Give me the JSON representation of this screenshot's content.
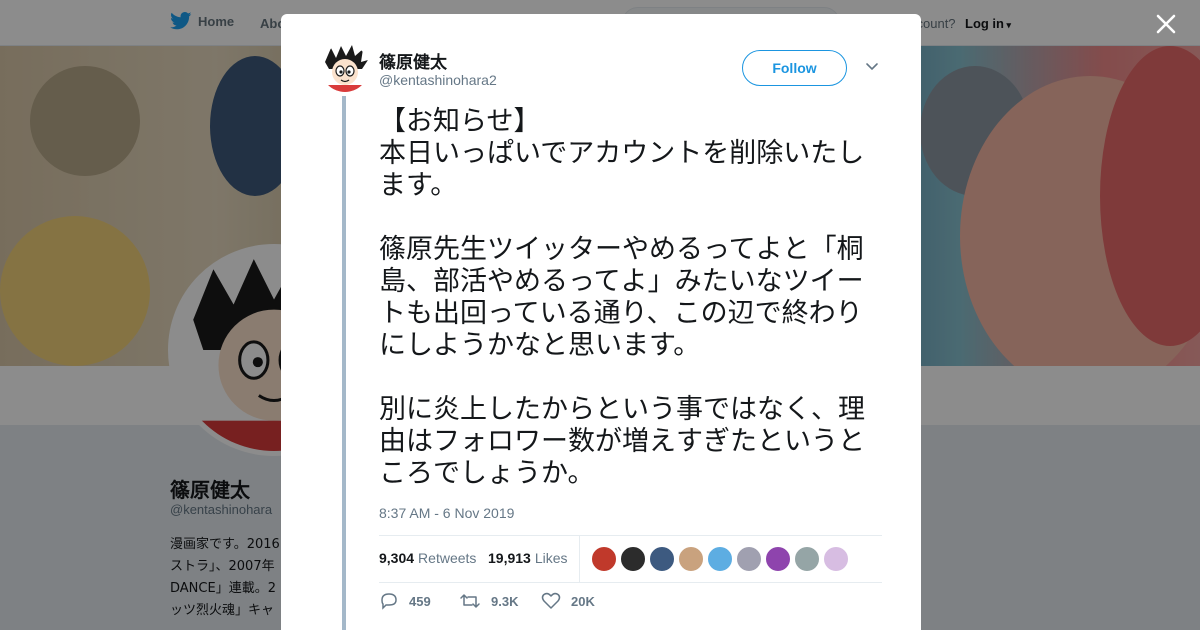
{
  "background_page": {
    "nav": {
      "home_label": "Home",
      "about_label": "Abo",
      "account_text": "ccount?",
      "login_label": "Log in"
    },
    "profile": {
      "name": "篠原健太",
      "handle": "@kentashinohara",
      "bio": "漫画家です。2016\nストラ」、2007年\nDANCE」連載。2\nッツ烈火魂」キャ"
    }
  },
  "modal": {
    "author": {
      "name": "篠原健太",
      "handle": "@kentashinohara2"
    },
    "follow_label": "Follow",
    "tweet_text": "【お知らせ】\n本日いっぱいでアカウントを削除いたします。\n\n篠原先生ツイッターやめるってよと「桐島、部活やめるってよ」みたいなツイートも出回っている通り、この辺で終わりにしようかなと思います。\n\n別に炎上したからという事ではなく、理由はフォロワー数が増えすぎたというところでしょうか。",
    "timestamp": "8:37 AM - 6 Nov 2019",
    "stats": {
      "retweets_count": "9,304",
      "retweets_label": "Retweets",
      "likes_count": "19,913",
      "likes_label": "Likes"
    },
    "liker_colors": [
      "#c0392b",
      "#2c2c2c",
      "#3d5a80",
      "#c9a27e",
      "#5dade2",
      "#a0a0b0",
      "#8e44ad",
      "#95a5a6",
      "#d7bde2"
    ],
    "actions": {
      "replies": "459",
      "retweets": "9.3K",
      "likes": "20K"
    }
  },
  "colors": {
    "accent": "#1b95e0",
    "twitter_blue": "#1da1f2",
    "thread_line": "#a4b8c9"
  },
  "icons": [
    "twitter-bird-icon",
    "close-icon",
    "chevron-down-icon",
    "reply-icon",
    "retweet-icon",
    "heart-icon"
  ]
}
